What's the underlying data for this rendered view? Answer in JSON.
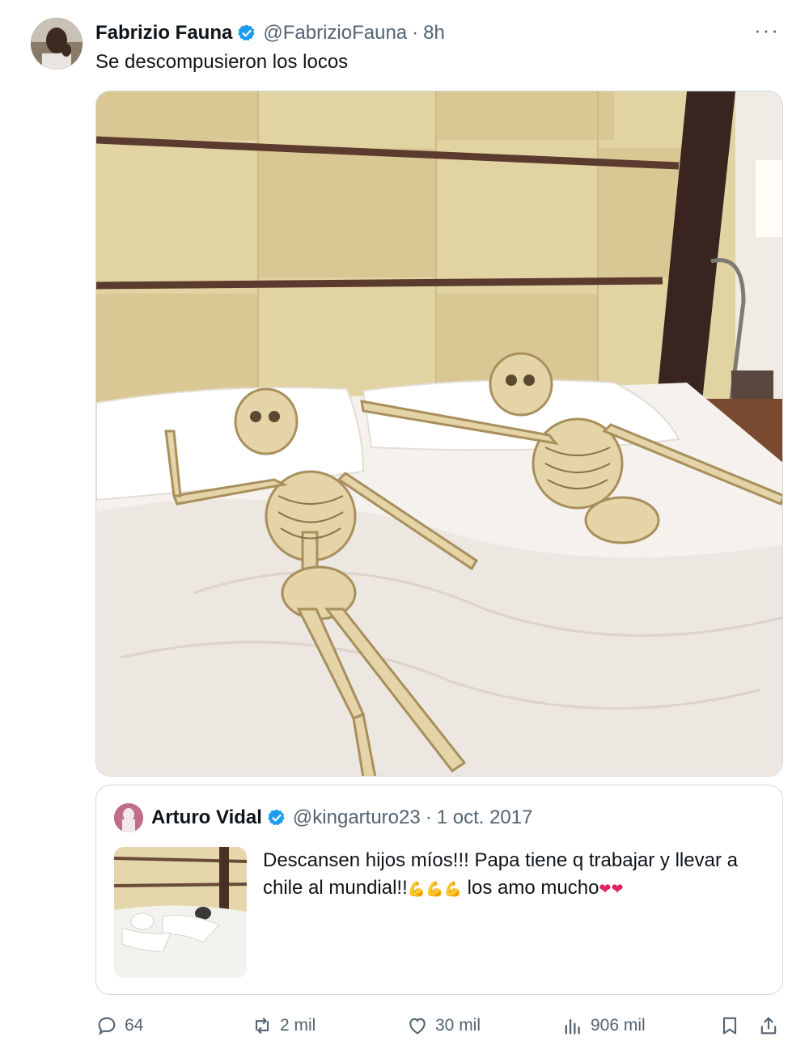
{
  "tweet": {
    "author_name": "Fabrizio Fauna",
    "author_handle": "@FabrizioFauna",
    "separator": "·",
    "time": "8h",
    "more_label": "···",
    "text": "Se descompusieron los locos"
  },
  "quoted_tweet": {
    "author_name": "Arturo Vidal",
    "author_handle": "@kingarturo23",
    "separator": "·",
    "date": "1 oct. 2017",
    "text_part1": "Descansen hijos míos!!! Papa tiene q trabajar y llevar a chile al mundial!!",
    "emojis_muscle": "💪💪💪",
    "text_part2": " los amo mucho",
    "emojis_heart": "❤❤"
  },
  "actions": {
    "replies": "64",
    "reposts": "2 mil",
    "likes": "30 mil",
    "views": "906 mil"
  },
  "icons": {
    "verified": "verified-badge-icon",
    "reply": "reply-icon",
    "repost": "repost-icon",
    "like": "heart-icon",
    "views": "views-chart-icon",
    "bookmark": "bookmark-icon",
    "share": "share-icon"
  },
  "colors": {
    "verified_blue": "#1d9bf0",
    "secondary_text": "#536471",
    "heart_red": "#e0245e"
  }
}
